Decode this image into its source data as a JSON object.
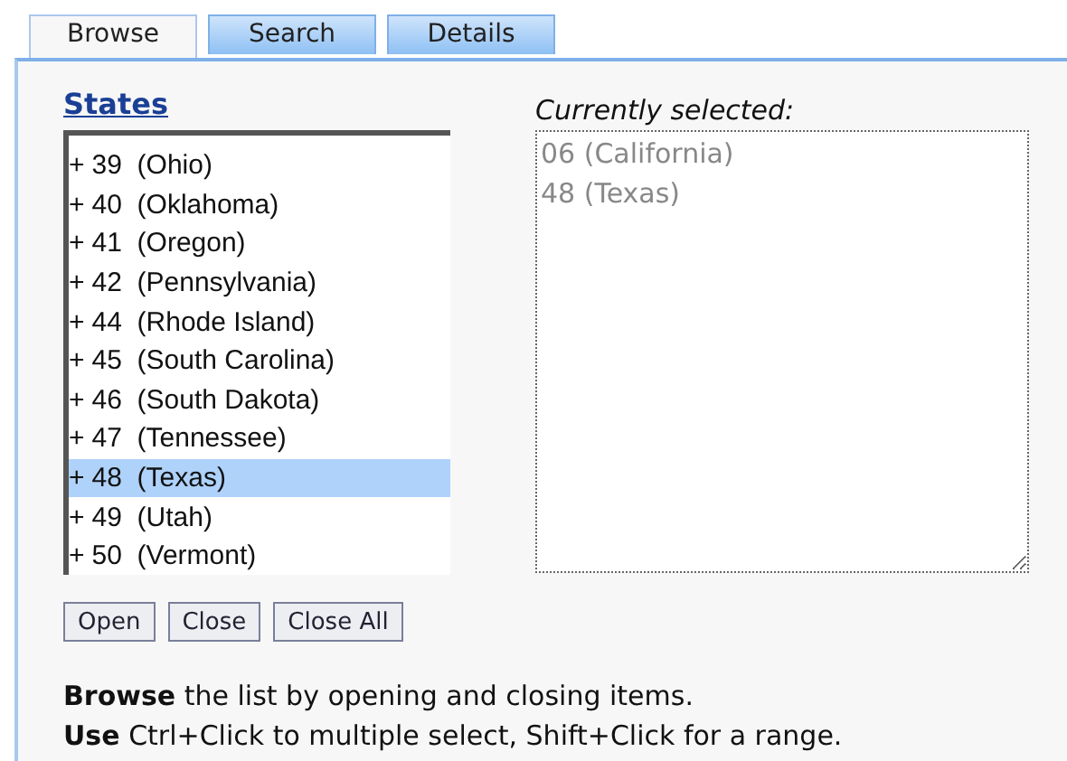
{
  "tabs": [
    {
      "label": "Browse",
      "selected": true
    },
    {
      "label": "Search",
      "selected": false
    },
    {
      "label": "Details",
      "selected": false
    }
  ],
  "states_link": "States",
  "tree": [
    {
      "toggle": "+",
      "code": "39",
      "name": "(Ohio)",
      "selected": false
    },
    {
      "toggle": "+",
      "code": "40",
      "name": "(Oklahoma)",
      "selected": false
    },
    {
      "toggle": "+",
      "code": "41",
      "name": "(Oregon)",
      "selected": false
    },
    {
      "toggle": "+",
      "code": "42",
      "name": "(Pennsylvania)",
      "selected": false
    },
    {
      "toggle": "+",
      "code": "44",
      "name": "(Rhode Island)",
      "selected": false
    },
    {
      "toggle": "+",
      "code": "45",
      "name": "(South Carolina)",
      "selected": false
    },
    {
      "toggle": "+",
      "code": "46",
      "name": "(South Dakota)",
      "selected": false
    },
    {
      "toggle": "+",
      "code": "47",
      "name": "(Tennessee)",
      "selected": false
    },
    {
      "toggle": "+",
      "code": "48",
      "name": "(Texas)",
      "selected": true
    },
    {
      "toggle": "+",
      "code": "49",
      "name": "(Utah)",
      "selected": false
    },
    {
      "toggle": "+",
      "code": "50",
      "name": "(Vermont)",
      "selected": false
    }
  ],
  "selected_label": "Currently selected:",
  "selected_value": "06 (California)\n48 (Texas)",
  "buttons": [
    "Open",
    "Close",
    "Close All"
  ],
  "help": [
    "**Browse** the list by opening and closing items.",
    "**Use** Ctrl+Click to multiple select, Shift+Click for a range."
  ]
}
